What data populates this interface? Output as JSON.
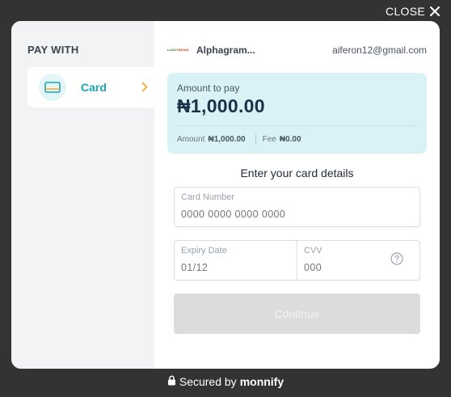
{
  "header": {
    "close_label": "CLOSE"
  },
  "sidebar": {
    "title": "PAY WITH",
    "methods": [
      {
        "label": "Card",
        "icon": "card-icon"
      }
    ]
  },
  "merchant": {
    "logo_text_a": "LUCKY",
    "logo_text_b": "BRAIN",
    "name": "Alphagram...",
    "email": "aiferon12@gmail.com"
  },
  "payment": {
    "amount_label": "Amount to pay",
    "amount_value": "₦1,000.00",
    "amount_small_label": "Amount",
    "amount_small_value": "₦1,000.00",
    "fee_label": "Fee",
    "fee_value": "₦0.00"
  },
  "form": {
    "title": "Enter your card details",
    "card_number_label": "Card Number",
    "card_number_placeholder": "0000 0000 0000 0000",
    "expiry_label": "Expiry Date",
    "expiry_placeholder": "01/12",
    "cvv_label": "CVV",
    "cvv_placeholder": "000",
    "continue_label": "Continue"
  },
  "footer": {
    "secured_prefix": "Secured by",
    "brand": "monnify"
  },
  "colors": {
    "accent": "#1aa6b7",
    "amount_bg": "#d9f2f5",
    "overlay": "#333333",
    "chevron": "#f5a524"
  }
}
